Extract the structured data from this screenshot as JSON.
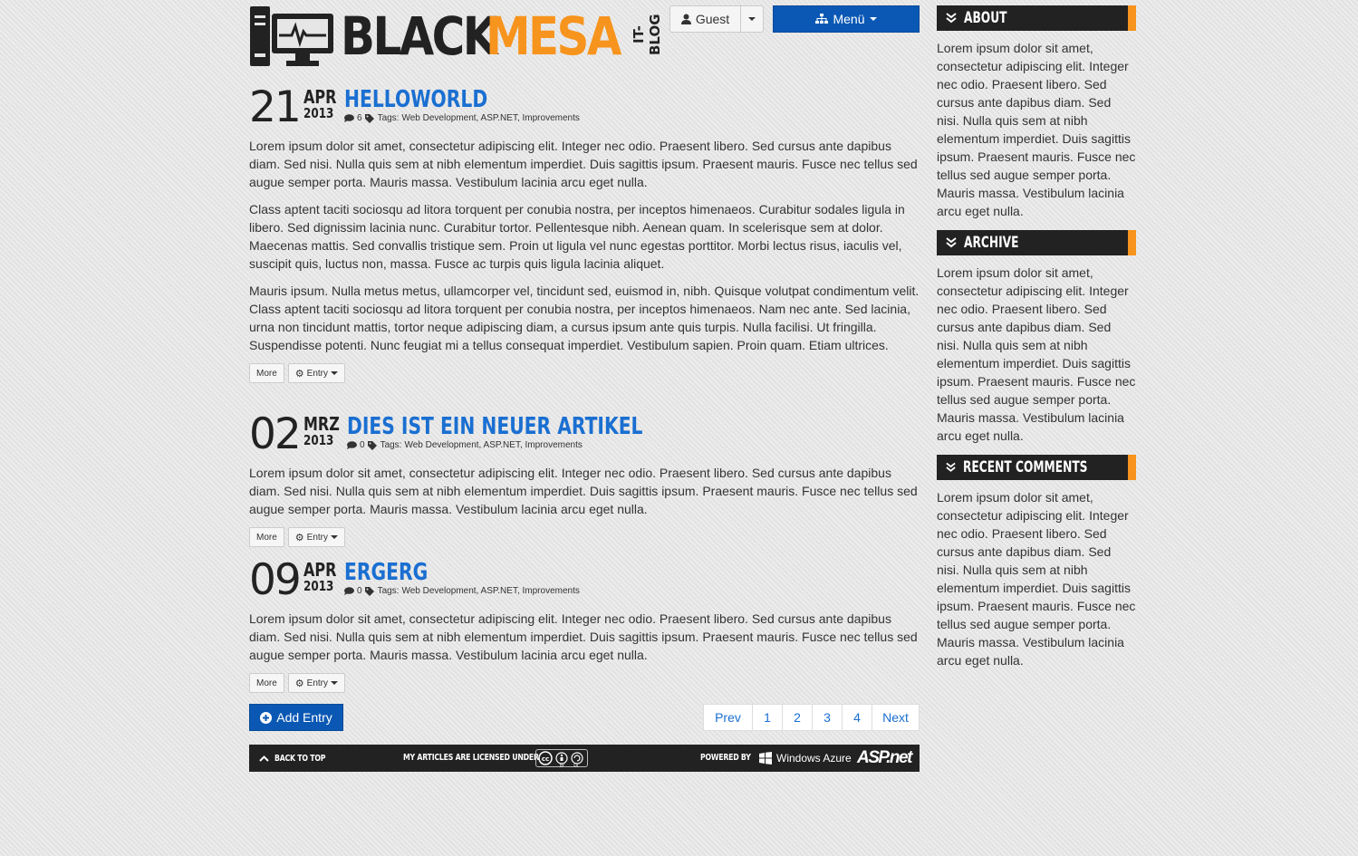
{
  "header": {
    "logo_black": "BLACK",
    "logo_mesa": "MESA",
    "logo_tag": "IT-BLOG",
    "guest_label": "Guest",
    "menu_label": "Menü"
  },
  "colors": {
    "accent": "#f7941d",
    "primary": "#0a58b4",
    "link": "#1a6fd1",
    "dark": "#222222"
  },
  "posts": [
    {
      "day": "21",
      "month": "APR",
      "year": "2013",
      "title": "HELLOWORLD",
      "comments": "6",
      "tags_label": "Tags:",
      "tags": "Web Development, ASP.NET, Improvements",
      "paragraphs": [
        "Lorem ipsum dolor sit amet, consectetur adipiscing elit. Integer nec odio. Praesent libero. Sed cursus ante dapibus diam. Sed nisi. Nulla quis sem at nibh elementum imperdiet. Duis sagittis ipsum. Praesent mauris. Fusce nec tellus sed augue semper porta. Mauris massa. Vestibulum lacinia arcu eget nulla.",
        "Class aptent taciti sociosqu ad litora torquent per conubia nostra, per inceptos himenaeos. Curabitur sodales ligula in libero. Sed dignissim lacinia nunc. Curabitur tortor. Pellentesque nibh. Aenean quam. In scelerisque sem at dolor. Maecenas mattis. Sed convallis tristique sem. Proin ut ligula vel nunc egestas porttitor. Morbi lectus risus, iaculis vel, suscipit quis, luctus non, massa. Fusce ac turpis quis ligula lacinia aliquet.",
        "Mauris ipsum. Nulla metus metus, ullamcorper vel, tincidunt sed, euismod in, nibh. Quisque volutpat condimentum velit. Class aptent taciti sociosqu ad litora torquent per conubia nostra, per inceptos himenaeos. Nam nec ante. Sed lacinia, urna non tincidunt mattis, tortor neque adipiscing diam, a cursus ipsum ante quis turpis. Nulla facilisi. Ut fringilla. Suspendisse potenti. Nunc feugiat mi a tellus consequat imperdiet. Vestibulum sapien. Proin quam. Etiam ultrices."
      ],
      "more_label": "More",
      "entry_label": "Entry"
    },
    {
      "day": "02",
      "month": "MRZ",
      "year": "2013",
      "title": "DIES IST EIN NEUER ARTIKEL",
      "comments": "0",
      "tags_label": "Tags:",
      "tags": "Web Development, ASP.NET, Improvements",
      "paragraphs": [
        "Lorem ipsum dolor sit amet, consectetur adipiscing elit. Integer nec odio. Praesent libero. Sed cursus ante dapibus diam. Sed nisi. Nulla quis sem at nibh elementum imperdiet. Duis sagittis ipsum. Praesent mauris. Fusce nec tellus sed augue semper porta. Mauris massa. Vestibulum lacinia arcu eget nulla."
      ],
      "more_label": "More",
      "entry_label": "Entry"
    },
    {
      "day": "09",
      "month": "APR",
      "year": "2013",
      "title": "ERGERG",
      "comments": "0",
      "tags_label": "Tags:",
      "tags": "Web Development, ASP.NET, Improvements",
      "paragraphs": [
        "Lorem ipsum dolor sit amet, consectetur adipiscing elit. Integer nec odio. Praesent libero. Sed cursus ante dapibus diam. Sed nisi. Nulla quis sem at nibh elementum imperdiet. Duis sagittis ipsum. Praesent mauris. Fusce nec tellus sed augue semper porta. Mauris massa. Vestibulum lacinia arcu eget nulla."
      ],
      "more_label": "More",
      "entry_label": "Entry"
    }
  ],
  "add_entry_label": "Add Entry",
  "pagination": [
    "Prev",
    "1",
    "2",
    "3",
    "4",
    "Next"
  ],
  "footer": {
    "back_to_top": "BACK TO TOP",
    "license": "MY ARTICLES ARE LICENSED UNDER",
    "cc_by": "BY",
    "cc_sa": "SA",
    "powered_by": "POWERED BY",
    "azure": "Windows Azure",
    "aspnet": "ASP.net"
  },
  "sidebar": [
    {
      "title": "ABOUT",
      "text": "Lorem ipsum dolor sit amet, consectetur adipiscing elit. Integer nec odio. Praesent libero. Sed cursus ante dapibus diam. Sed nisi. Nulla quis sem at nibh elementum imperdiet. Duis sagittis ipsum. Praesent mauris. Fusce nec tellus sed augue semper porta. Mauris massa. Vestibulum lacinia arcu eget nulla."
    },
    {
      "title": "ARCHIVE",
      "text": "Lorem ipsum dolor sit amet, consectetur adipiscing elit. Integer nec odio. Praesent libero. Sed cursus ante dapibus diam. Sed nisi. Nulla quis sem at nibh elementum imperdiet. Duis sagittis ipsum. Praesent mauris. Fusce nec tellus sed augue semper porta. Mauris massa. Vestibulum lacinia arcu eget nulla."
    },
    {
      "title": "RECENT COMMENTS",
      "text": "Lorem ipsum dolor sit amet, consectetur adipiscing elit. Integer nec odio. Praesent libero. Sed cursus ante dapibus diam. Sed nisi. Nulla quis sem at nibh elementum imperdiet. Duis sagittis ipsum. Praesent mauris. Fusce nec tellus sed augue semper porta. Mauris massa. Vestibulum lacinia arcu eget nulla."
    }
  ]
}
